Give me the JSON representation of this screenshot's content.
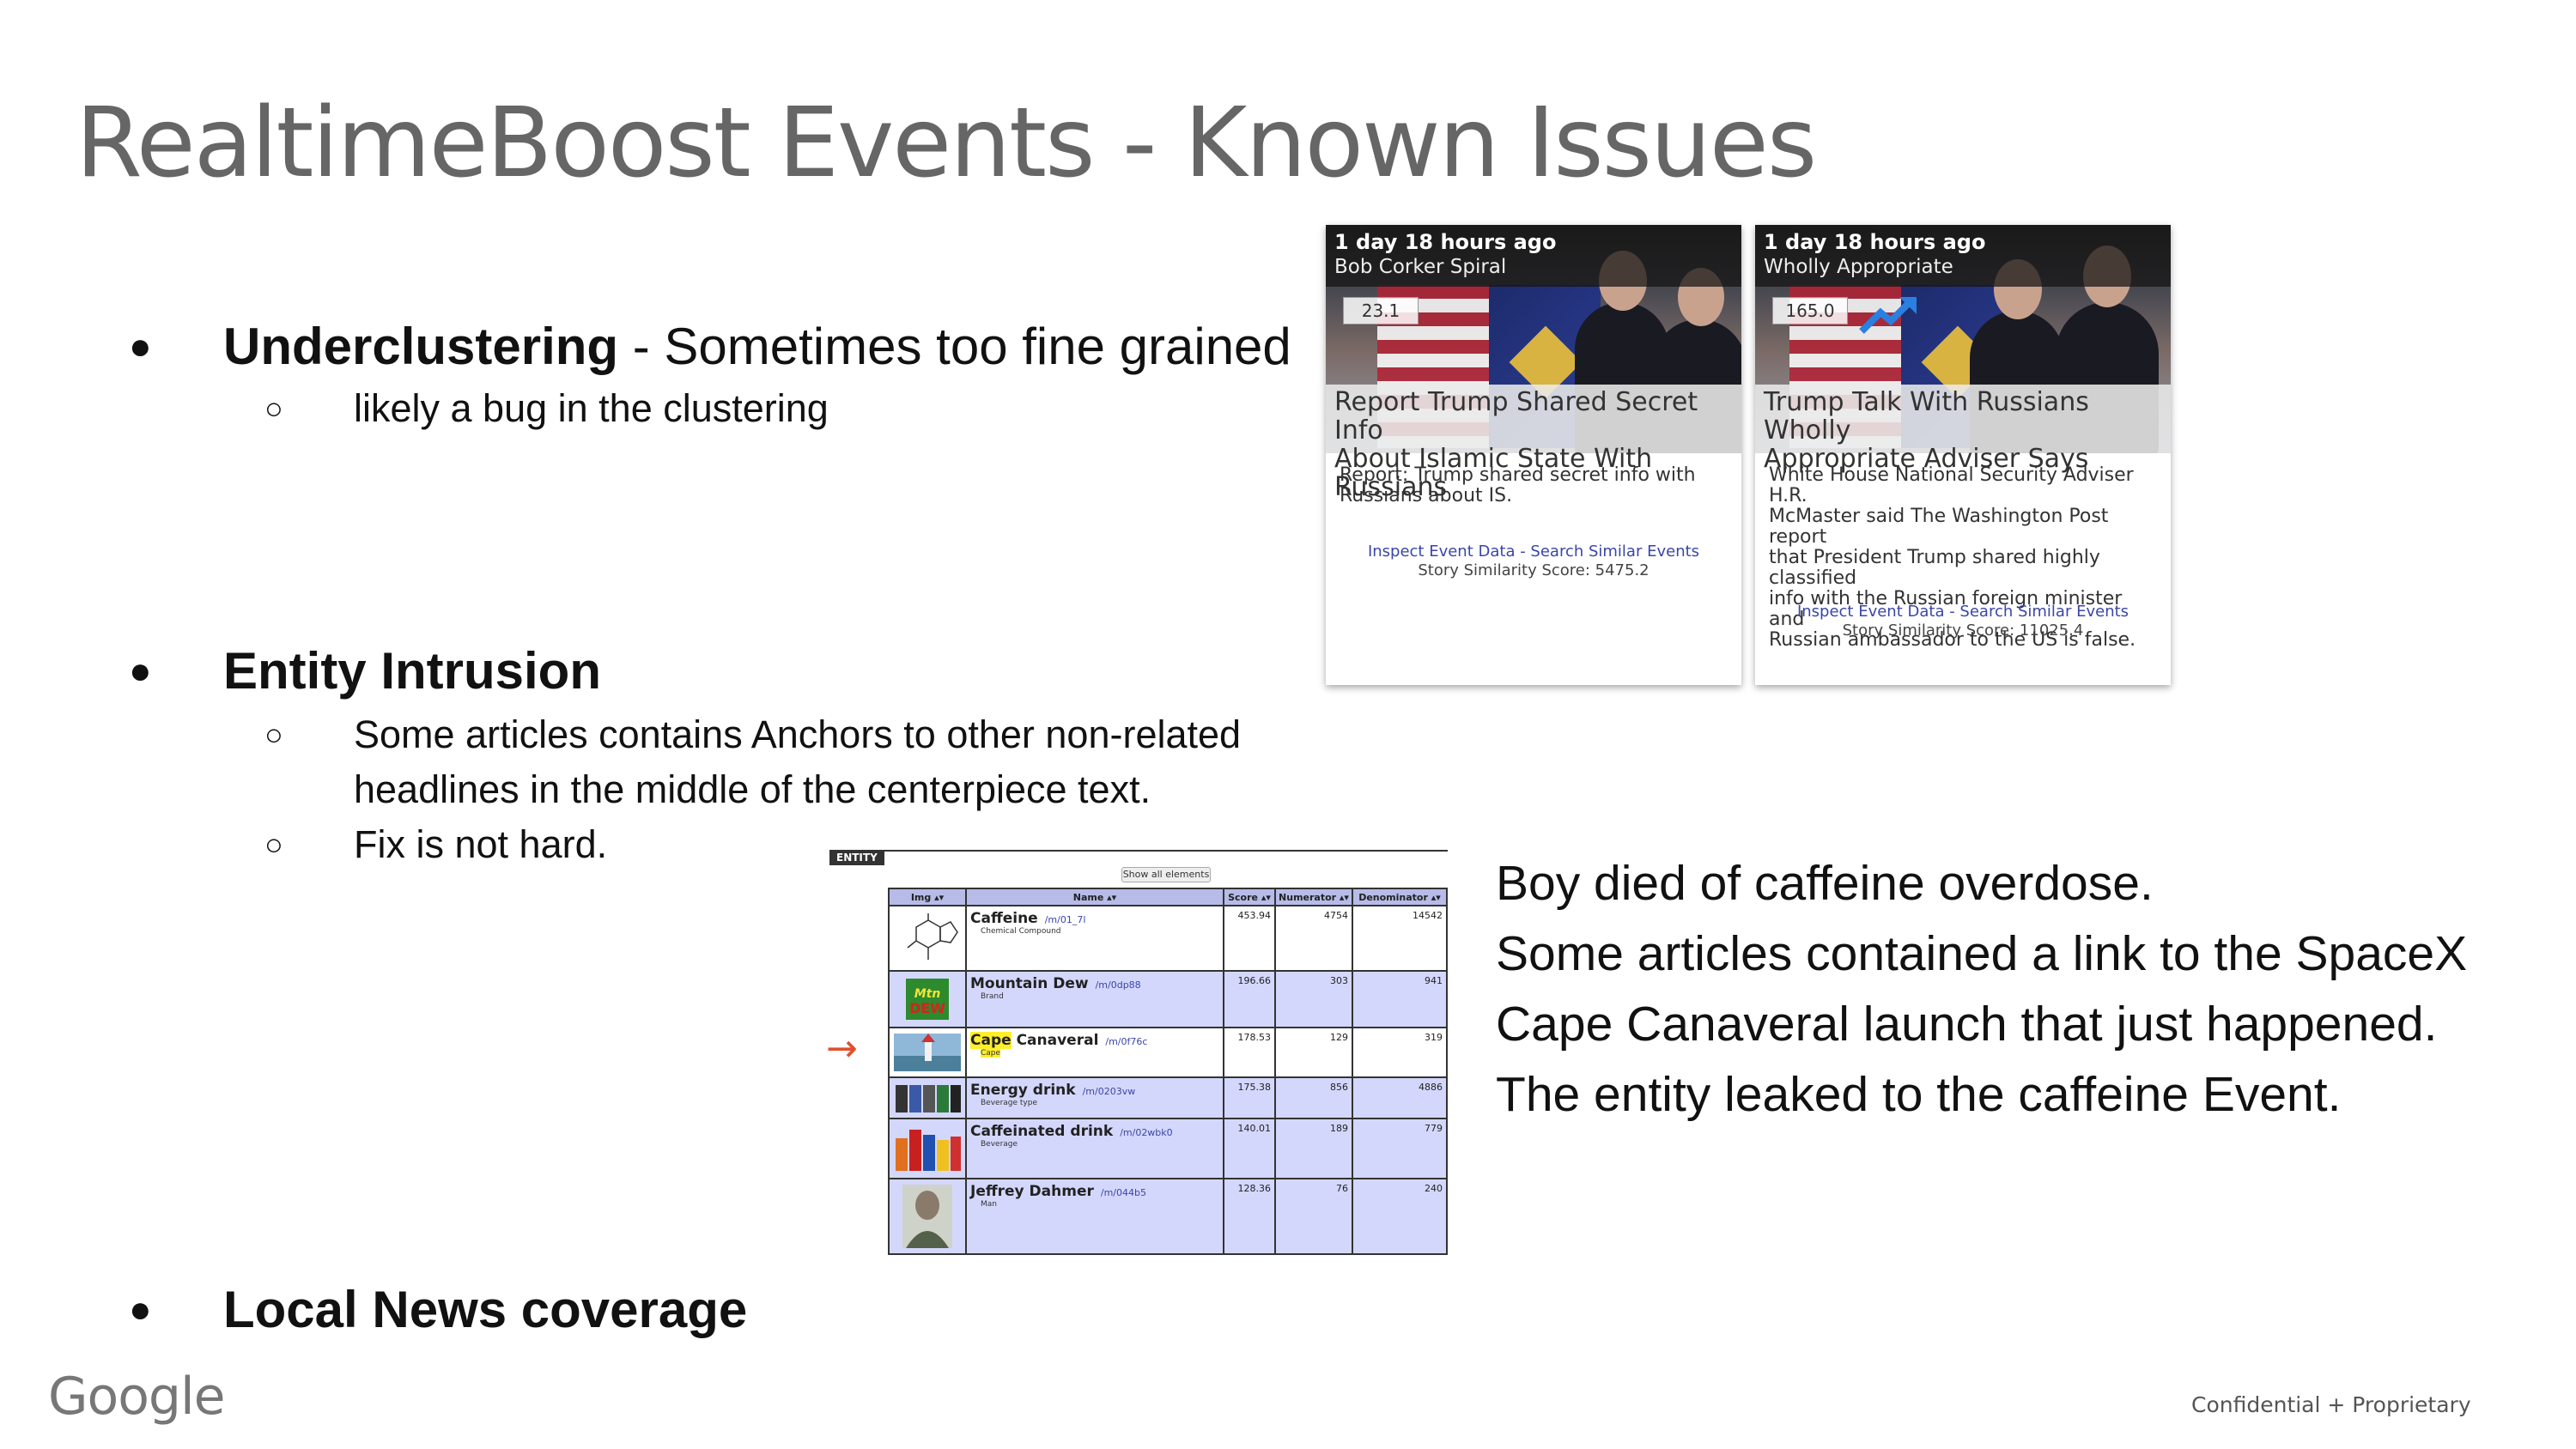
{
  "slide": {
    "title": "RealtimeBoost Events - Known Issues"
  },
  "bullets": {
    "dot": "●",
    "sub_dot": "○",
    "underclustering": {
      "bold": "Underclustering",
      "rest": " - Sometimes too fine grained",
      "sub": [
        "likely a bug in the clustering"
      ]
    },
    "entity_intrusion": {
      "bold": "Entity Intrusion",
      "sub": [
        "Some articles contains Anchors to other non-related",
        "headlines in the middle of the centerpiece text.",
        "Fix is not hard."
      ]
    },
    "local_news": {
      "bold": "Local News coverage"
    }
  },
  "cards": [
    {
      "time": "1 day 18 hours ago",
      "source": "Bob Corker Spiral",
      "score": "23.1",
      "trending_icon": "none",
      "headline_lines": [
        "Report Trump Shared Secret Info",
        "About Islamic State With Russians"
      ],
      "description_lines": [
        "Report: Trump shared secret info with",
        "Russians about IS."
      ],
      "link": "Inspect Event Data - Search Similar Events",
      "similarity": "Story Similarity Score: 5475.2"
    },
    {
      "time": "1 day 18 hours ago",
      "source": "Wholly Appropriate",
      "score": "165.0",
      "trending_icon": "trend-up-arrow",
      "headline_lines": [
        "Trump Talk With Russians Wholly",
        "Appropriate Adviser Says"
      ],
      "description_lines": [
        "White House National Security Adviser H.R.",
        "McMaster said The Washington Post report",
        "that President Trump shared highly classified",
        "info with the Russian foreign minister and",
        "Russian ambassador to the US is false."
      ],
      "link": "Inspect Event Data - Search Similar Events",
      "similarity": "Story Similarity Score: 11025.4"
    }
  ],
  "entity_table": {
    "tag": "ENTITY",
    "show_all": "Show all elements",
    "columns": [
      "Img ▴▾",
      "Name ▴▾",
      "Score ▴▾",
      "Numerator ▴▾",
      "Denominator ▴▾"
    ],
    "rows": [
      {
        "name": "Caffeine",
        "mid": "/m/01_7l",
        "type": "Chemical Compound",
        "score": "453.94",
        "numerator": "4754",
        "denominator": "14542",
        "thumb": "molecule-icon",
        "highlight": ""
      },
      {
        "name": "Mountain Dew",
        "mid": "/m/0dp88",
        "type": "Brand",
        "score": "196.66",
        "numerator": "303",
        "denominator": "941",
        "thumb": "soda-can-icon",
        "highlight": ""
      },
      {
        "name": " Canaveral",
        "highlight": "Cape",
        "mid": "/m/0f76c",
        "type": "Cape",
        "score": "178.53",
        "numerator": "129",
        "denominator": "319",
        "thumb": "coast-photo-icon"
      },
      {
        "name": "Energy drink",
        "mid": "/m/0203vw",
        "type": "Beverage type",
        "score": "175.38",
        "numerator": "856",
        "denominator": "4886",
        "thumb": "cans-photo-icon",
        "highlight": ""
      },
      {
        "name": "Caffeinated drink",
        "mid": "/m/02wbk0",
        "type": "Beverage",
        "score": "140.01",
        "numerator": "189",
        "denominator": "779",
        "thumb": "bottles-photo-icon",
        "highlight": ""
      },
      {
        "name": "Jeffrey Dahmer",
        "mid": "/m/044b5",
        "type": "Man",
        "score": "128.36",
        "numerator": "76",
        "denominator": "240",
        "thumb": "portrait-photo-icon",
        "highlight": ""
      }
    ],
    "arrow": "→"
  },
  "story_text": [
    "Boy died of caffeine overdose.",
    "Some articles contained a link to the SpaceX",
    "Cape Canaveral launch that just happened.",
    "The entity leaked to the caffeine Event."
  ],
  "footer": {
    "logo": "Google",
    "note": "Confidential + Proprietary"
  }
}
